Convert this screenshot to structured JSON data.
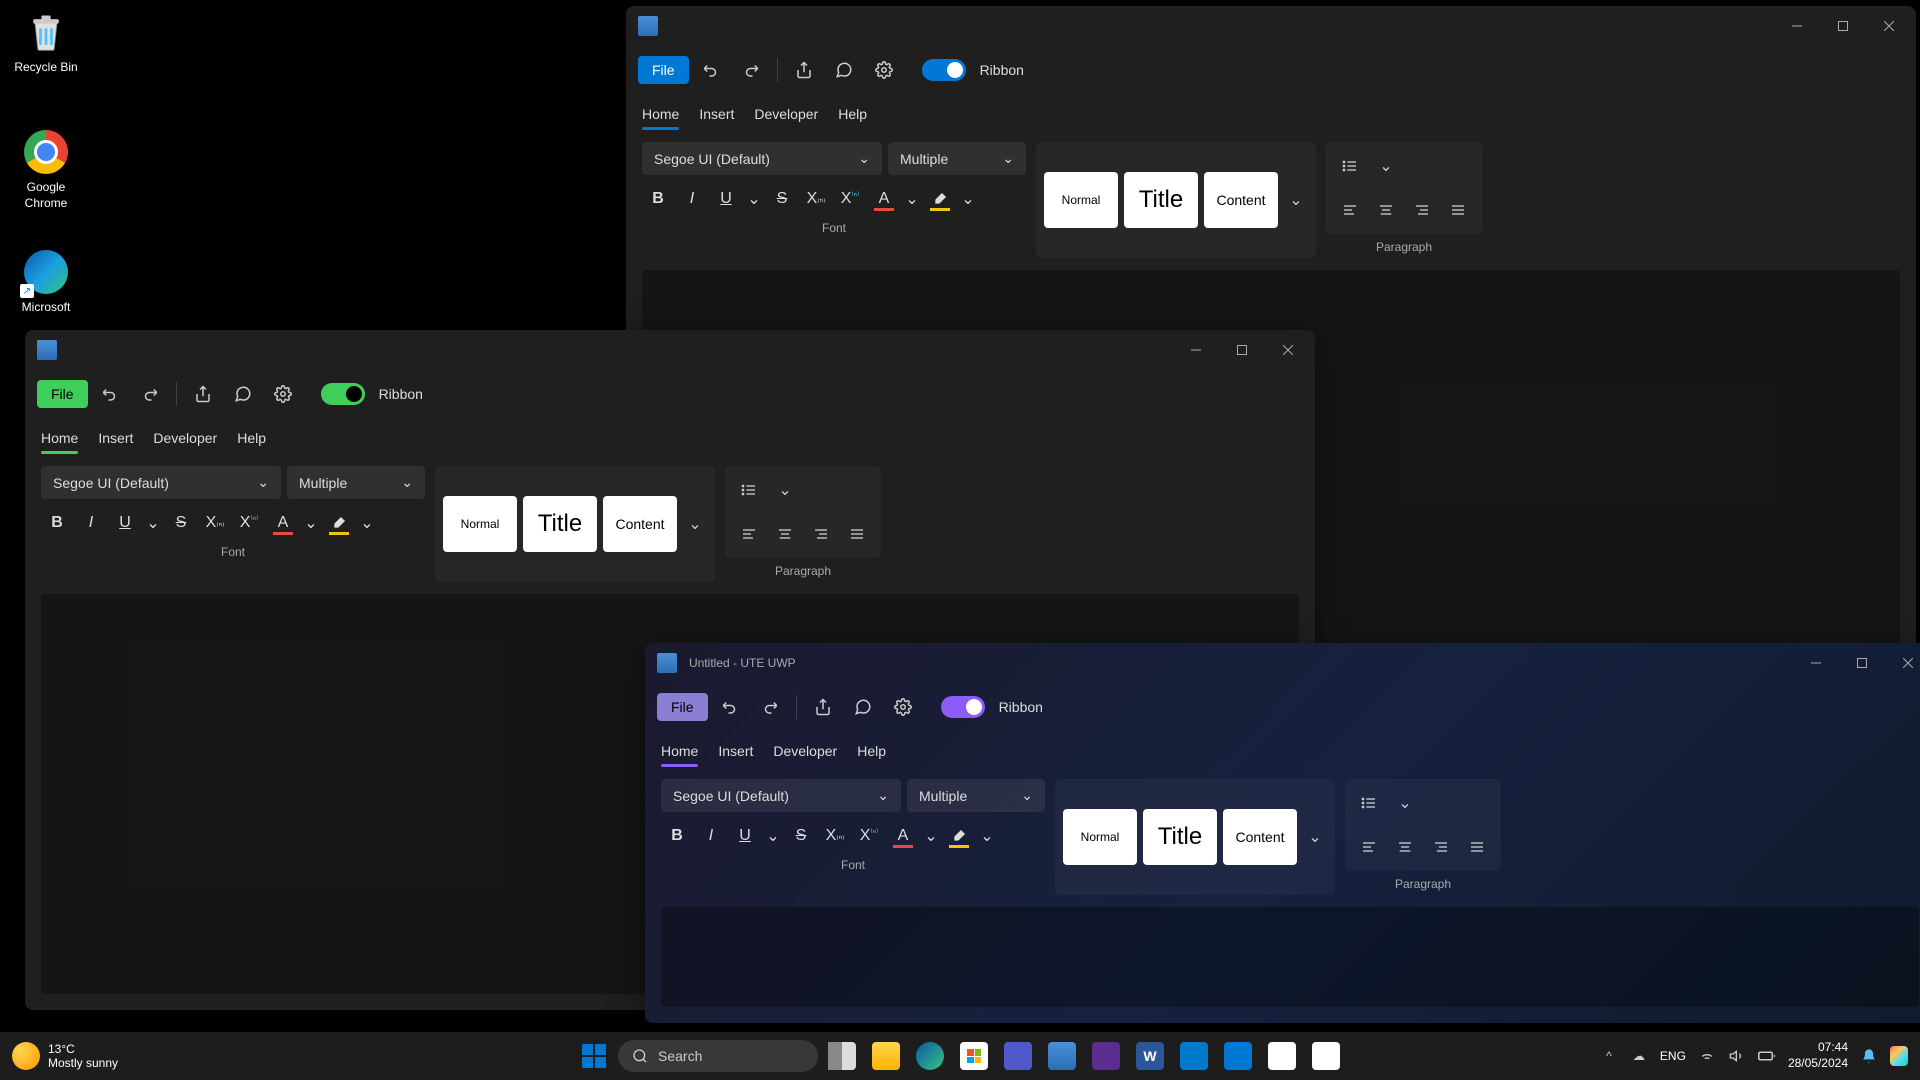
{
  "desktop": {
    "recycle_bin": "Recycle Bin",
    "chrome": "Google Chrome",
    "edge": "Microsoft"
  },
  "windows": [
    {
      "id": "win1",
      "title": "",
      "accent": "blue",
      "file_label": "File",
      "ribbon_label": "Ribbon",
      "tabs": [
        "Home",
        "Insert",
        "Developer",
        "Help"
      ],
      "active_tab": 0,
      "font_name": "Segoe UI (Default)",
      "font_size": "Multiple",
      "styles": [
        {
          "name": "Normal",
          "class": "normal"
        },
        {
          "name": "Title",
          "class": "title"
        },
        {
          "name": "Content",
          "class": "content"
        }
      ],
      "group_font": "Font",
      "group_paragraph": "Paragraph"
    },
    {
      "id": "win2",
      "title": "",
      "accent": "green",
      "file_label": "File",
      "ribbon_label": "Ribbon",
      "tabs": [
        "Home",
        "Insert",
        "Developer",
        "Help"
      ],
      "active_tab": 0,
      "font_name": "Segoe UI (Default)",
      "font_size": "Multiple",
      "styles": [
        {
          "name": "Normal",
          "class": "normal"
        },
        {
          "name": "Title",
          "class": "title"
        },
        {
          "name": "Content",
          "class": "content"
        }
      ],
      "group_font": "Font",
      "group_paragraph": "Paragraph"
    },
    {
      "id": "win3",
      "title": "Untitled - UTE UWP",
      "accent": "purple",
      "file_label": "File",
      "ribbon_label": "Ribbon",
      "tabs": [
        "Home",
        "Insert",
        "Developer",
        "Help"
      ],
      "active_tab": 0,
      "font_name": "Segoe UI (Default)",
      "font_size": "Multiple",
      "styles": [
        {
          "name": "Normal",
          "class": "normal"
        },
        {
          "name": "Title",
          "class": "title"
        },
        {
          "name": "Content",
          "class": "content"
        }
      ],
      "group_font": "Font",
      "group_paragraph": "Paragraph"
    }
  ],
  "taskbar": {
    "weather_temp": "13°C",
    "weather_desc": "Mostly sunny",
    "search_placeholder": "Search",
    "lang": "ENG",
    "time": "07:44",
    "date": "28/05/2024"
  }
}
